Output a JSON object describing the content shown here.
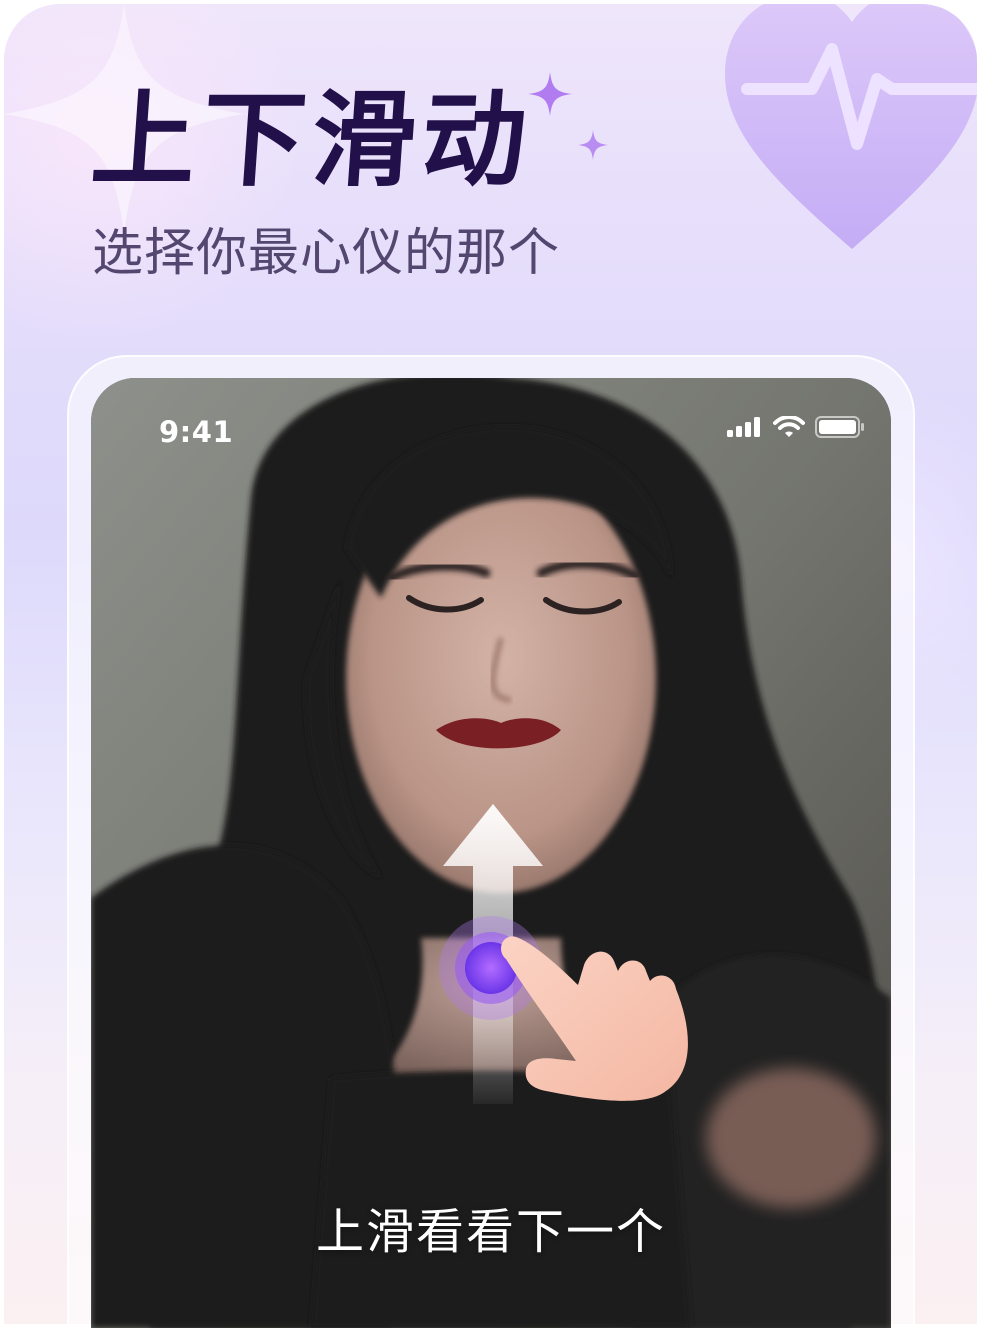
{
  "header": {
    "title": "上下滑动",
    "subtitle": "选择你最心仪的那个"
  },
  "phone": {
    "status_bar": {
      "time": "9:41",
      "icons": [
        "cellular-signal-icon",
        "wifi-icon",
        "battery-icon"
      ]
    },
    "photo": "blurred portrait of a woman with long dark hair wearing a black top",
    "gesture_hint": {
      "icons": [
        "swipe-up-arrow-icon",
        "touch-point-icon",
        "pointing-hand-icon"
      ],
      "caption": "上滑看看下一个"
    }
  },
  "decorations": [
    "four-point-star-icon",
    "sparkle-icon",
    "heart-pulse-icon"
  ],
  "colors": {
    "title": "#22104a",
    "subtitle": "#53466f",
    "background_top": "#efe6fb",
    "background_bottom": "#fbf0f2",
    "heart": "#c9a6f5",
    "touch_point": "#8a4cf0",
    "hand": "#f7c2b0"
  }
}
